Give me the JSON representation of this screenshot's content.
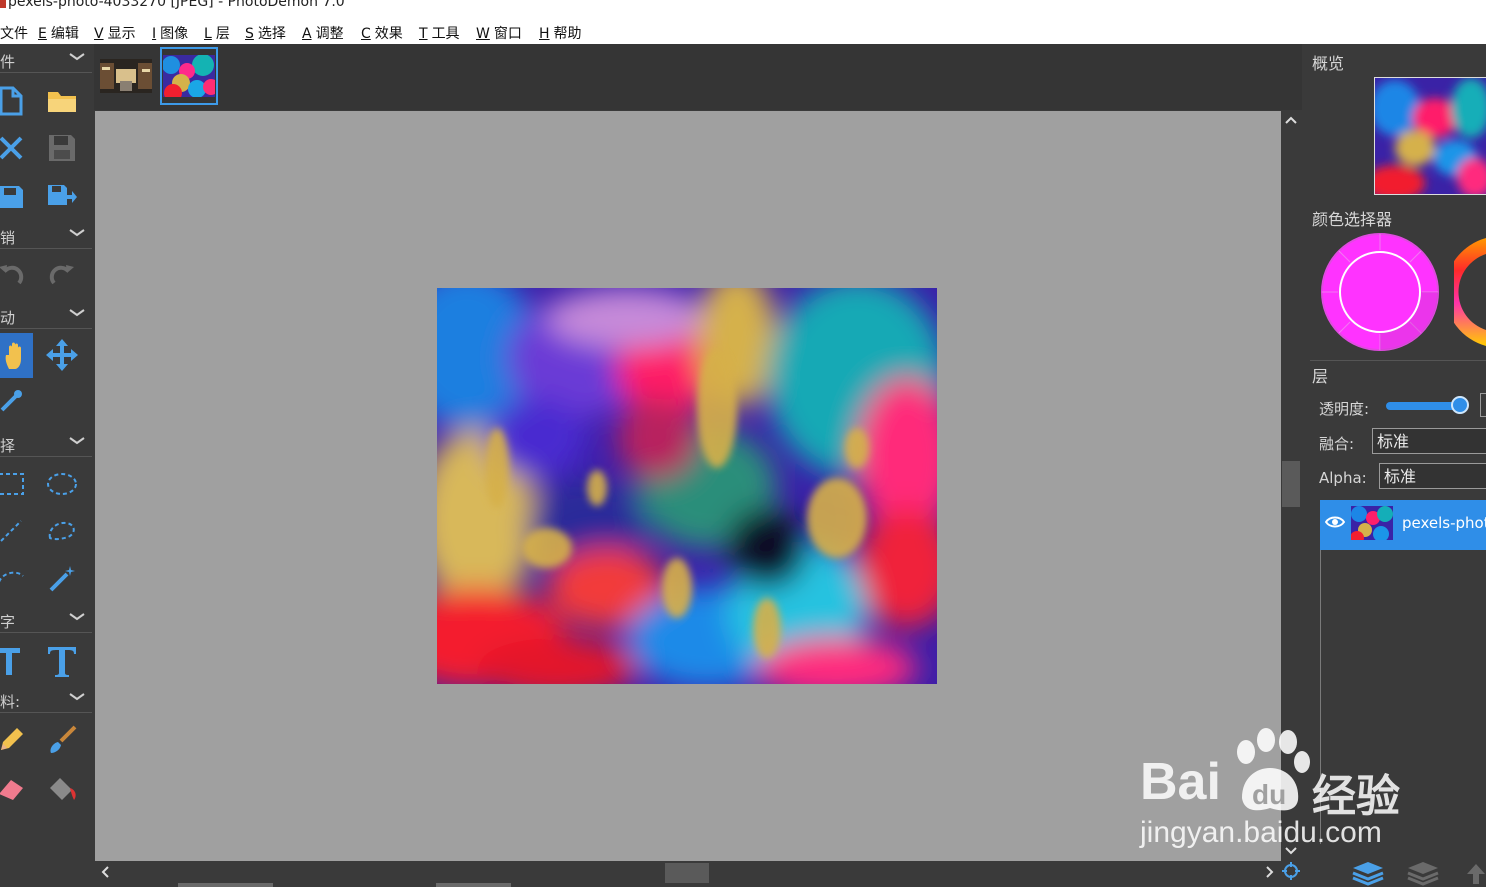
{
  "window": {
    "title": "pexels-photo-4033270 [JPEG]  -  PhotoDemon 7.0"
  },
  "menu": [
    {
      "key": "",
      "label": "文件"
    },
    {
      "key": "E",
      "label": "编辑"
    },
    {
      "key": "V",
      "label": "显示"
    },
    {
      "key": "I",
      "label": "图像"
    },
    {
      "key": "L",
      "label": "层"
    },
    {
      "key": "S",
      "label": "选择"
    },
    {
      "key": "A",
      "label": "调整"
    },
    {
      "key": "C",
      "label": "效果"
    },
    {
      "key": "T",
      "label": "工具"
    },
    {
      "key": "W",
      "label": "窗口"
    },
    {
      "key": "H",
      "label": "帮助"
    }
  ],
  "toolbox": {
    "sections": [
      "件",
      "销",
      "动",
      "择",
      "字",
      "料:"
    ]
  },
  "right_panel": {
    "overview_title": "概览",
    "color_picker_title": "颜色选择器",
    "layers_title": "层",
    "opacity_label": "透明度:",
    "opacity_value": 1.0,
    "blend_label": "融合:",
    "blend_value": "标准",
    "alpha_label": "Alpha:",
    "alpha_value": "标准",
    "layer_name": "pexels-photo"
  },
  "colors": {
    "primary_color": "#ff33ff",
    "accent": "#2f8ee8"
  },
  "watermark": {
    "brand": "Bai",
    "brand2": "经验",
    "url": "jingyan.baidu.com"
  }
}
